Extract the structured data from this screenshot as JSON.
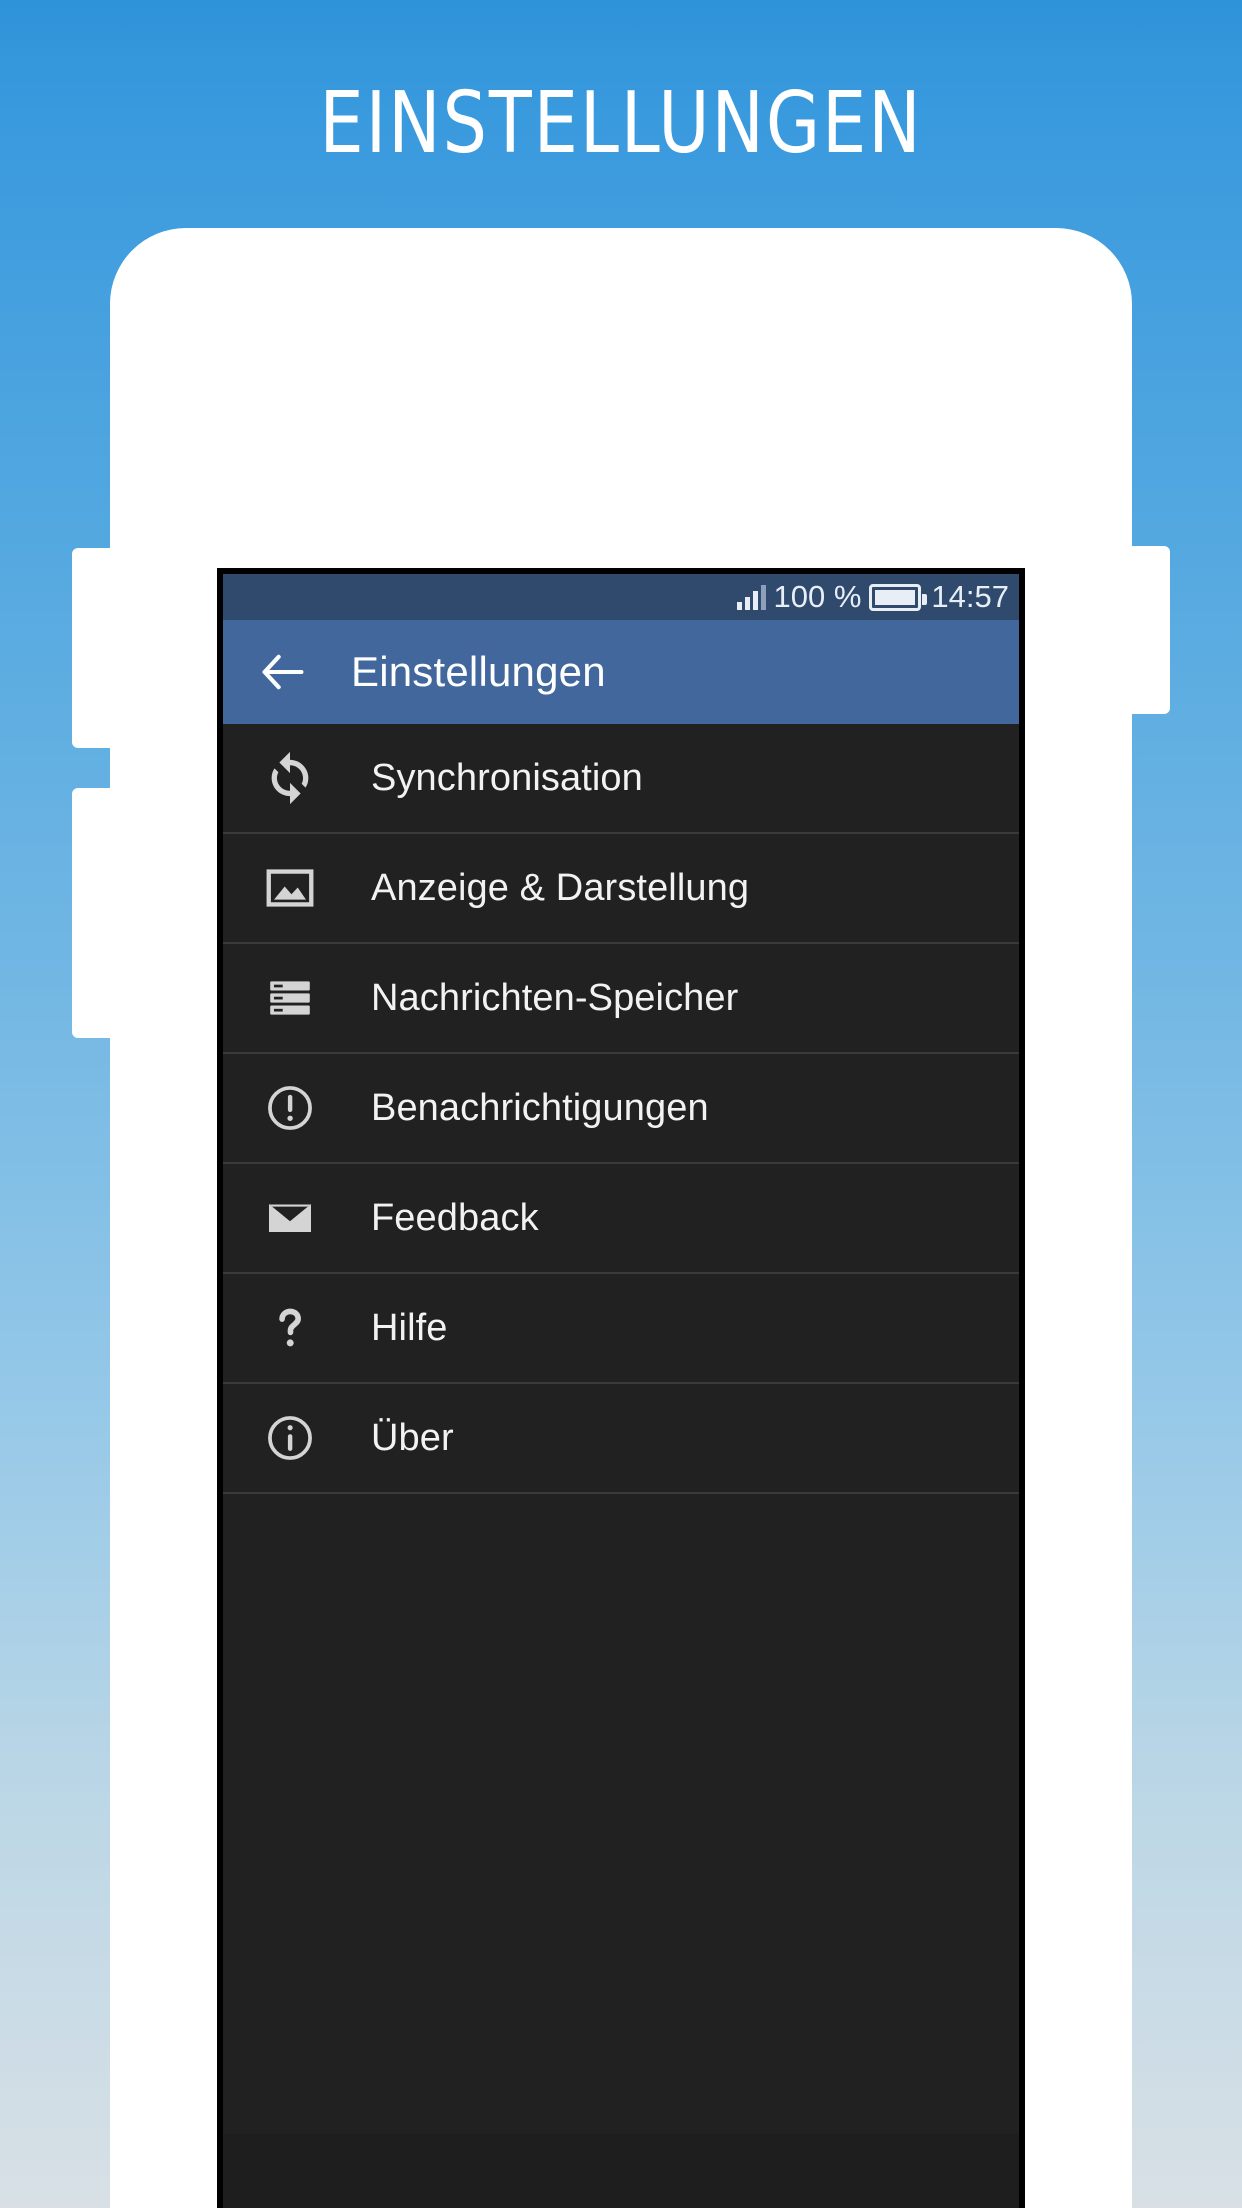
{
  "poster": {
    "title": "Einstellungen",
    "background_top_color": "#2f93d9",
    "background_bottom_color": "#d8e0e5"
  },
  "statusbar": {
    "signal_icon": "signal-bars-icon",
    "battery_percent": "100 %",
    "battery_icon": "battery-full-icon",
    "clock": "14:57",
    "background_color": "#2f4a6d"
  },
  "appbar": {
    "back_icon": "back-arrow-icon",
    "title": "Einstellungen",
    "background_color": "#41679d"
  },
  "settings_list": {
    "items": [
      {
        "icon": "sync-icon",
        "label": "Synchronisation"
      },
      {
        "icon": "image-icon",
        "label": "Anzeige & Darstellung"
      },
      {
        "icon": "storage-icon",
        "label": "Nachrichten-Speicher"
      },
      {
        "icon": "alert-circle-icon",
        "label": "Benachrichtigungen"
      },
      {
        "icon": "envelope-icon",
        "label": "Feedback"
      },
      {
        "icon": "question-mark-icon",
        "label": "Hilfe"
      },
      {
        "icon": "info-circle-icon",
        "label": "Über"
      }
    ],
    "row_background_color": "#212121",
    "divider_color": "#3a3a3a",
    "label_color": "#f2f2f2",
    "icon_color": "#d4d4d4"
  }
}
